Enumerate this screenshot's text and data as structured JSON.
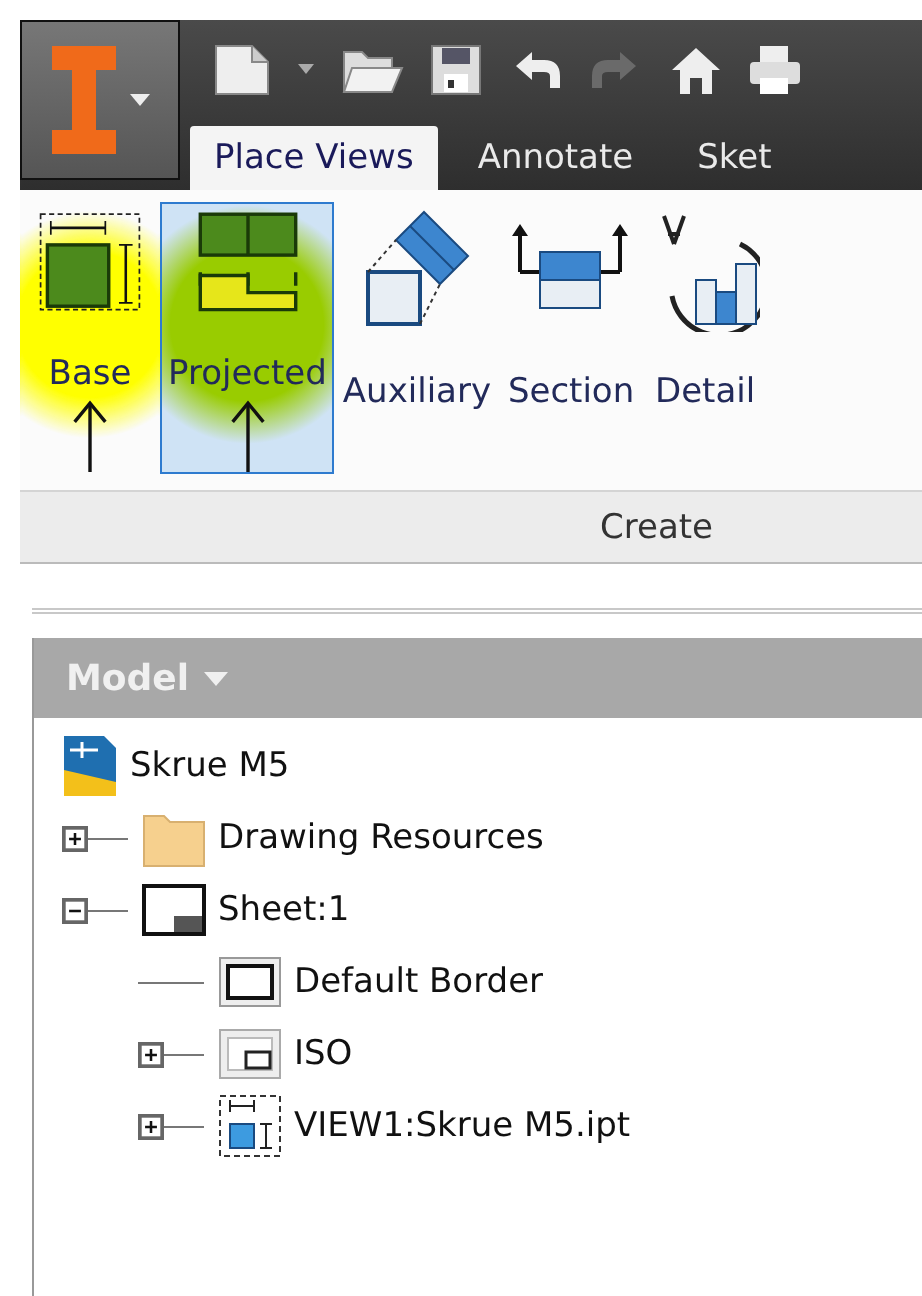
{
  "tabs": [
    {
      "label": "Place Views",
      "selected": true
    },
    {
      "label": "Annotate",
      "selected": false
    },
    {
      "label": "Sket",
      "selected": false
    }
  ],
  "ribbon": {
    "buttons": [
      {
        "label": "Base",
        "kind": "base",
        "selected": false,
        "color": "#ffff00",
        "arrow": true
      },
      {
        "label": "Projected",
        "kind": "projected",
        "selected": true,
        "color": "#99cc00",
        "arrow": true
      },
      {
        "label": "Auxiliary",
        "kind": "auxiliary",
        "selected": false,
        "arrow": false
      },
      {
        "label": "Section",
        "kind": "section",
        "selected": false,
        "arrow": false
      },
      {
        "label": "Detail",
        "kind": "detail",
        "selected": false,
        "arrow": false
      }
    ],
    "panel_label": "Create"
  },
  "browser": {
    "title": "Model",
    "tree": [
      {
        "label": "Skrue M5",
        "kind": "drawing",
        "children": [
          {
            "label": "Drawing Resources",
            "kind": "folder",
            "expanded": false
          },
          {
            "label": "Sheet:1",
            "kind": "sheet",
            "expanded": true,
            "children": [
              {
                "label": "Default Border",
                "kind": "border"
              },
              {
                "label": "ISO",
                "kind": "format",
                "expanded": false
              },
              {
                "label": "VIEW1:Skrue M5.ipt",
                "kind": "view",
                "expanded": false
              }
            ]
          }
        ]
      }
    ]
  }
}
